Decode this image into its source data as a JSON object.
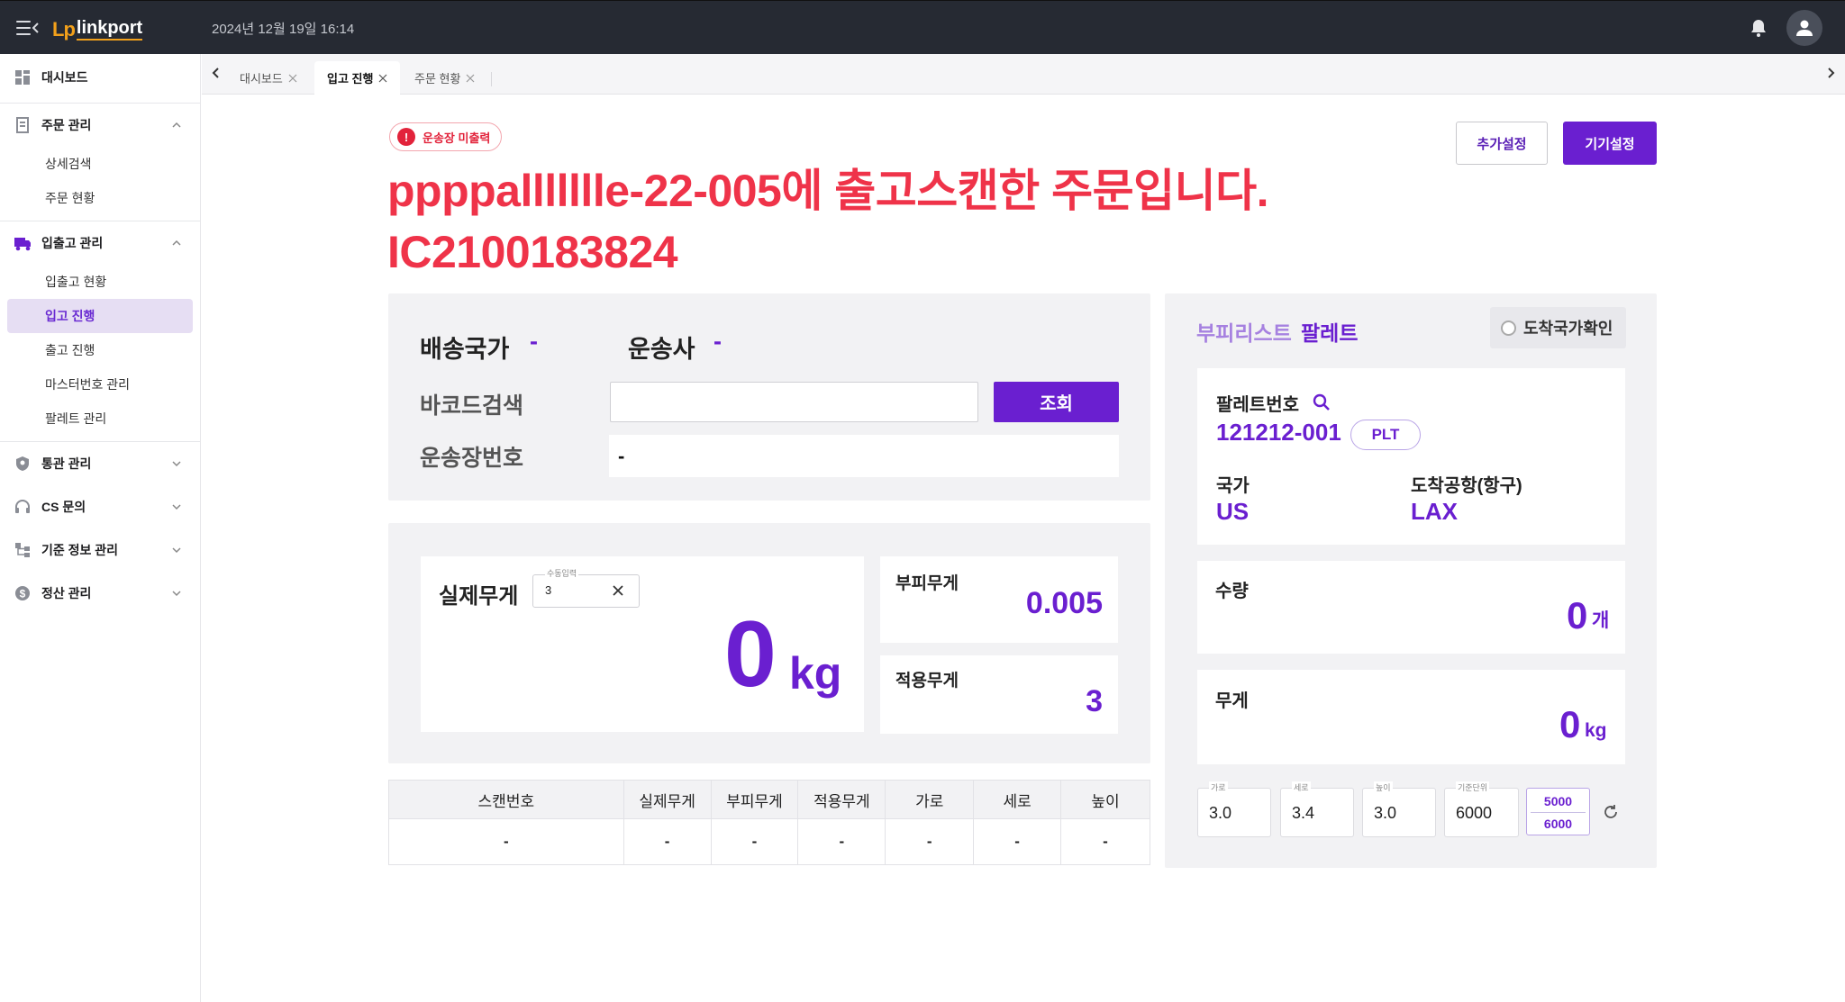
{
  "app": {
    "logo_mark": "Lp",
    "logo_text": "linkport",
    "datetime": "2024년 12월 19일 16:14"
  },
  "sidebar": {
    "groups": [
      {
        "label": "대시보드",
        "icon": "dashboard-icon"
      },
      {
        "label": "주문 관리",
        "icon": "document-icon",
        "expanded": true,
        "items": [
          "상세검색",
          "주문 현황"
        ]
      },
      {
        "label": "입출고 관리",
        "icon": "truck-icon",
        "expanded": true,
        "items": [
          "입출고 현황",
          "입고 진행",
          "출고 진행",
          "마스터번호 관리",
          "팔레트 관리"
        ],
        "active_item": "입고 진행"
      },
      {
        "label": "통관 관리",
        "icon": "shield-icon"
      },
      {
        "label": "CS 문의",
        "icon": "headset-icon"
      },
      {
        "label": "기준 정보 관리",
        "icon": "hierarchy-icon"
      },
      {
        "label": "정산 관리",
        "icon": "dollar-icon"
      }
    ]
  },
  "tabs": [
    {
      "label": "대시보드",
      "active": false
    },
    {
      "label": "입고 진행",
      "active": true
    },
    {
      "label": "주문 현황",
      "active": false
    }
  ],
  "alert": {
    "badge": "운송장 미출력",
    "headline_line1": "ppppallllllle-22-005에 출고스캔한 주문입니다.",
    "headline_line2": "IC2100183824",
    "color": "#ef3349"
  },
  "header_buttons": {
    "extra_settings": "추가설정",
    "device_settings": "기기설정"
  },
  "shipment": {
    "country_label": "배송국가",
    "country_value": "-",
    "carrier_label": "운송사",
    "carrier_value": "-",
    "barcode_label": "바코드검색",
    "barcode_value": "",
    "search_button": "조회",
    "waybill_label": "운송장번호",
    "waybill_value": "-"
  },
  "weights": {
    "actual_label": "실제무게",
    "manual_caption": "수동입력",
    "manual_value": "3",
    "actual_value": "0",
    "actual_unit": "kg",
    "volume_label": "부피무게",
    "volume_value": "0.005",
    "applied_label": "적용무게",
    "applied_value": "3"
  },
  "scan_table": {
    "columns": [
      "스캔번호",
      "실제무게",
      "부피무게",
      "적용무게",
      "가로",
      "세로",
      "높이"
    ],
    "rows": [
      [
        "-",
        "-",
        "-",
        "-",
        "-",
        "-",
        "-"
      ]
    ]
  },
  "pallet_panel": {
    "tab_bag": "부피리스트",
    "tab_pallet": "팔레트",
    "arrival_check": "도착국가확인",
    "pallet_number_label": "팔레트번호",
    "pallet_number": "121212-001",
    "pallet_type": "PLT",
    "country_label": "국가",
    "country_value": "US",
    "airport_label": "도착공항(항구)",
    "airport_value": "LAX",
    "quantity_label": "수량",
    "quantity_value": "0",
    "quantity_unit": "개",
    "weight_label": "무게",
    "weight_value": "0",
    "weight_unit": "kg"
  },
  "dimensions": {
    "width_caption": "가로",
    "width_value": "3.0",
    "length_caption": "세로",
    "length_value": "3.4",
    "height_caption": "높이",
    "height_value": "3.0",
    "divisor_caption": "기준단위",
    "divisor_value": "6000",
    "option_a": "5000",
    "option_b": "6000"
  },
  "colors": {
    "accent": "#6a1fd0",
    "alert": "#ef3349",
    "topbar": "#262a33",
    "active_nav_bg": "#e6def3"
  }
}
